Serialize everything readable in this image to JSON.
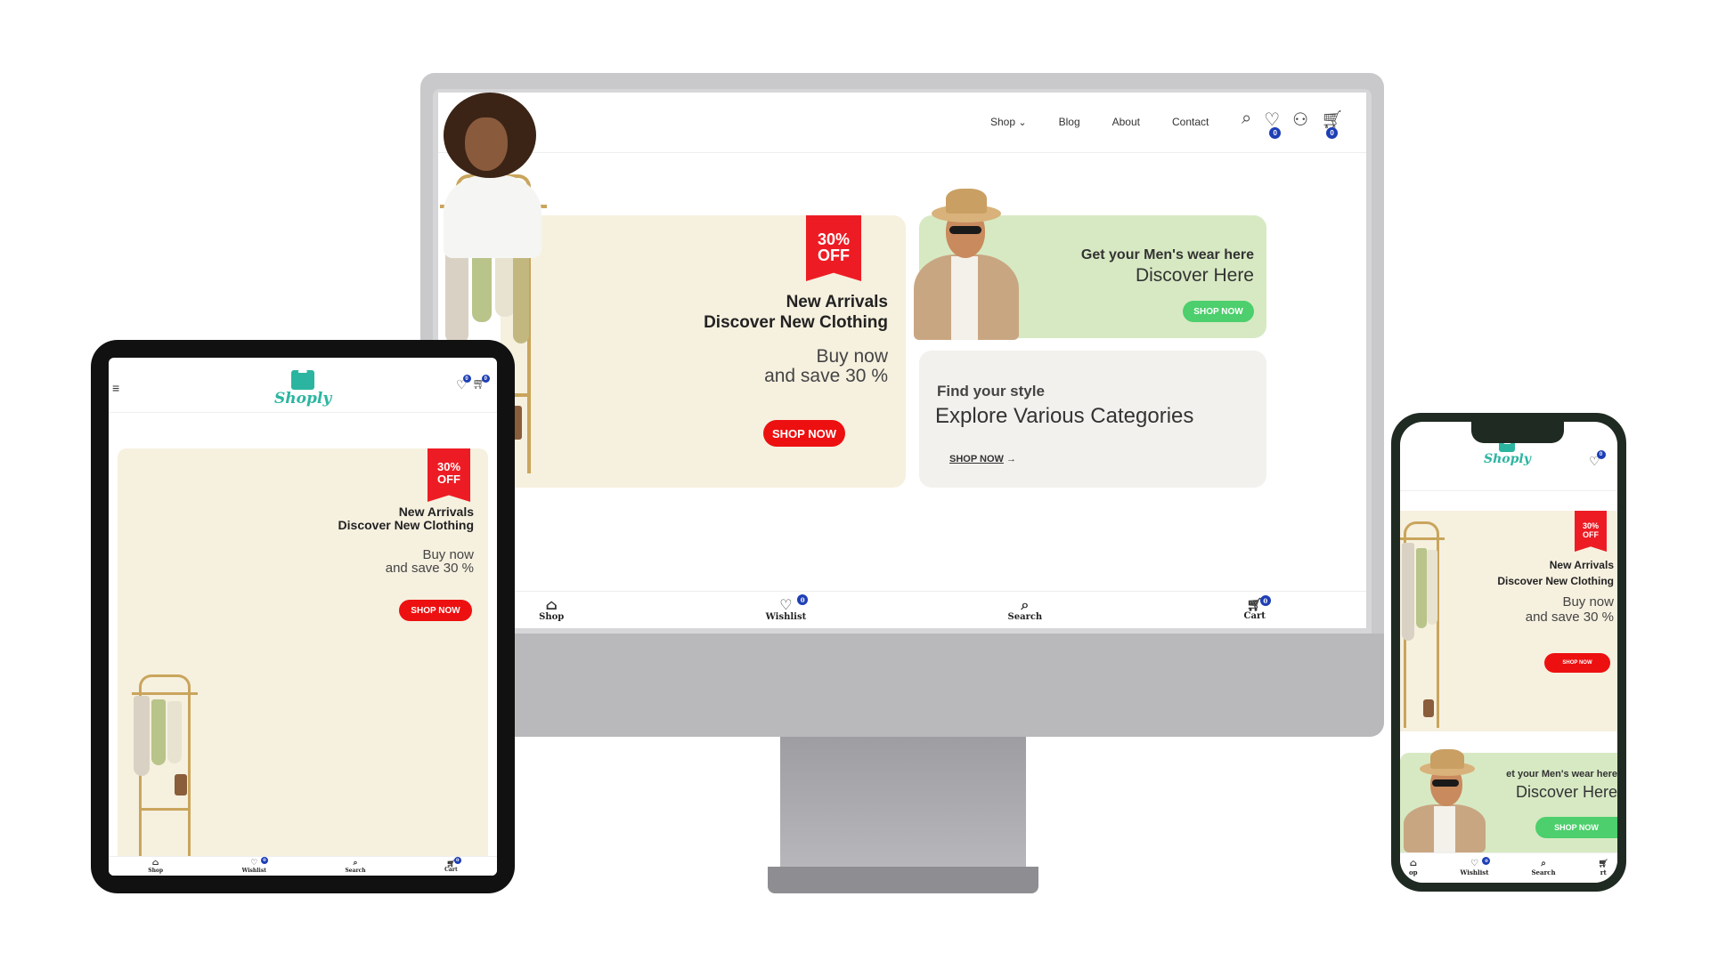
{
  "brand": {
    "name": "Shoply",
    "color": "#2bb5a0"
  },
  "desktop": {
    "nav": {
      "links": [
        "Shop",
        "Blog",
        "About",
        "Contact"
      ],
      "shop_chevron": "⌄",
      "wishlist_count": "0",
      "cart_count": "0"
    },
    "hero": {
      "badge_line1": "30%",
      "badge_line2": "OFF",
      "title_line1": "New Arrivals",
      "title_line2": "Discover New Clothing",
      "sub_line1": "Buy now",
      "sub_line2": "and save 30 %",
      "button": "SHOP NOW"
    },
    "men_card": {
      "title": "Get your Men's wear here",
      "subtitle": "Discover Here",
      "button": "SHOP NOW"
    },
    "style_card": {
      "title": "Find your style",
      "subtitle": "Explore Various Categories",
      "link": "SHOP NOW",
      "arrow": "→"
    },
    "bottom_nav": [
      {
        "label": "Shop",
        "icon": "home-icon"
      },
      {
        "label": "Wishlist",
        "icon": "heart-icon",
        "count": "0"
      },
      {
        "label": "Search",
        "icon": "search-icon"
      },
      {
        "label": "Cart",
        "icon": "cart-icon",
        "count": "0"
      }
    ]
  },
  "tablet": {
    "wishlist_count": "0",
    "cart_count": "0",
    "hero": {
      "badge_line1": "30%",
      "badge_line2": "OFF",
      "title_line1": "New Arrivals",
      "title_line2": "Discover New Clothing",
      "sub_line1": "Buy now",
      "sub_line2": "and save 30 %",
      "button": "SHOP NOW"
    },
    "bottom_nav": [
      "Shop",
      "Wishlist",
      "Search",
      "Cart"
    ],
    "wishlist_badge": "0",
    "cart_badge": "0"
  },
  "phone": {
    "wishlist_count": "0",
    "hero": {
      "badge_line1": "30%",
      "badge_line2": "OFF",
      "title_line1": "New Arrivals",
      "title_line2": "Discover New Clothing",
      "sub_line1": "Buy now",
      "sub_line2": "and save 30 %",
      "button": "SHOP NOW"
    },
    "men_card": {
      "title": "et your Men's wear here",
      "subtitle": "Discover Here",
      "button": "SHOP NOW"
    },
    "bottom_nav": [
      "op",
      "Wishlist",
      "Search",
      "rt"
    ],
    "wishlist_badge": "0"
  },
  "colors": {
    "hero_bg": "#f6f0df",
    "men_bg": "#d7e9c3",
    "style_bg": "#f2f1ee",
    "red": "#ed1010",
    "green": "#4ccf6c",
    "badge_blue": "#1e3fb5"
  }
}
